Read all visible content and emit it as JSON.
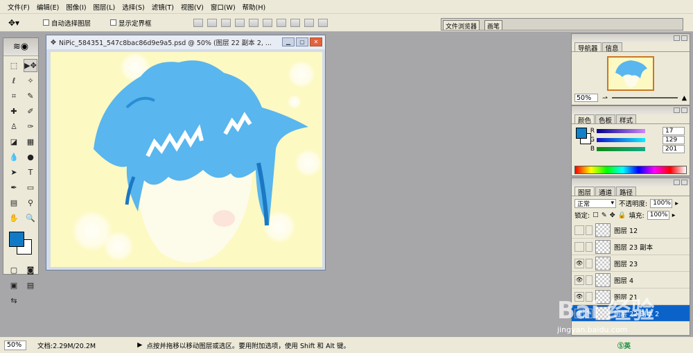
{
  "menu": [
    "文件(F)",
    "编辑(E)",
    "图像(I)",
    "图层(L)",
    "选择(S)",
    "滤镜(T)",
    "视图(V)",
    "窗口(W)",
    "帮助(H)"
  ],
  "options": {
    "auto_select": "自动选择图层",
    "show_bounds": "显示定界框"
  },
  "palette_well": {
    "tab1": "文件浏览器",
    "tab2": "画笔"
  },
  "document": {
    "title": "NiPic_584351_547c8bac86d9e9a5.psd @ 50% (图层 22 副本 2, ..."
  },
  "navigator": {
    "tabs": [
      "导航器",
      "信息"
    ],
    "zoom": "50%"
  },
  "color_panel": {
    "tabs": [
      "颜色",
      "色板",
      "样式"
    ],
    "r_label": "R",
    "g_label": "G",
    "b_label": "B",
    "r": "17",
    "g": "129",
    "b": "201",
    "foreground": "#1181c9"
  },
  "layers_panel": {
    "tabs": [
      "图层",
      "通道",
      "路径"
    ],
    "blend_mode": "正常",
    "opacity_label": "不透明度:",
    "opacity": "100%",
    "lock_label": "锁定:",
    "fill_label": "填充:",
    "fill": "100%",
    "layers": [
      {
        "name": "图层 12",
        "visible": false
      },
      {
        "name": "图层 23 副本",
        "visible": false
      },
      {
        "name": "图层 23",
        "visible": true
      },
      {
        "name": "图层 4",
        "visible": true
      },
      {
        "name": "图层 21",
        "visible": true
      },
      {
        "name": "图层 22 副本 2",
        "visible": true,
        "selected": true
      }
    ]
  },
  "status": {
    "zoom": "50%",
    "doc_size": "文档:2.29M/20.2M",
    "hint": "点按并拖移以移动图层或选区。要用附加选项，使用 Shift 和 Alt 键。"
  },
  "watermark": {
    "text": "Bai 经验",
    "sub": "jingyan.baidu.com"
  }
}
